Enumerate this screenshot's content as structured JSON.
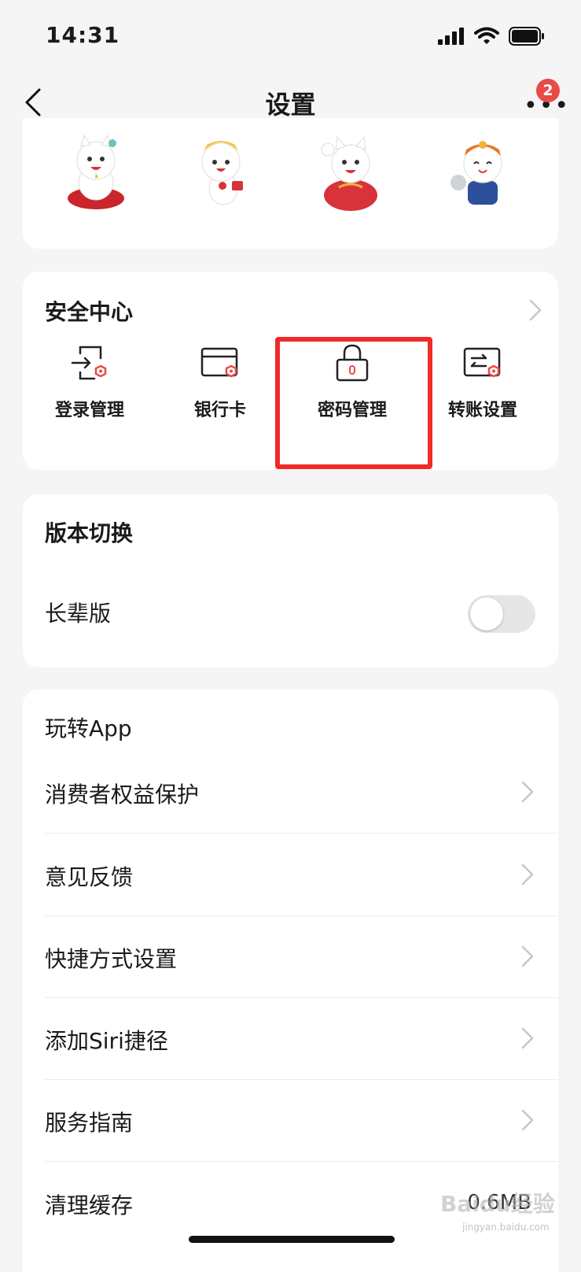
{
  "status_bar": {
    "time": "14:31"
  },
  "nav": {
    "title": "设置",
    "badge_count": "2"
  },
  "mascots": [
    "cat-mascot-1",
    "cat-mascot-2",
    "cat-mascot-3",
    "cat-mascot-4"
  ],
  "security": {
    "title": "安全中心",
    "items": [
      {
        "label": "登录管理",
        "icon": "login-manage-icon"
      },
      {
        "label": "银行卡",
        "icon": "bank-card-icon"
      },
      {
        "label": "密码管理",
        "icon": "lock-icon"
      },
      {
        "label": "转账设置",
        "icon": "transfer-settings-icon"
      }
    ],
    "highlighted_item": "密码管理"
  },
  "version": {
    "title": "版本切换",
    "elder_label": "长辈版",
    "elder_enabled": false
  },
  "app": {
    "title": "玩转App",
    "items": [
      "消费者权益保护",
      "意见反馈",
      "快捷方式设置",
      "添加Siri捷径",
      "服务指南"
    ],
    "cache_label": "清理缓存",
    "cache_value": "0.6MB"
  },
  "colors": {
    "accent": "#e94b47",
    "highlight_border": "#ef2b27",
    "background": "#f5f5f5"
  },
  "watermark": {
    "text": "Baidu经验",
    "sub": "jingyan.baidu.com"
  }
}
